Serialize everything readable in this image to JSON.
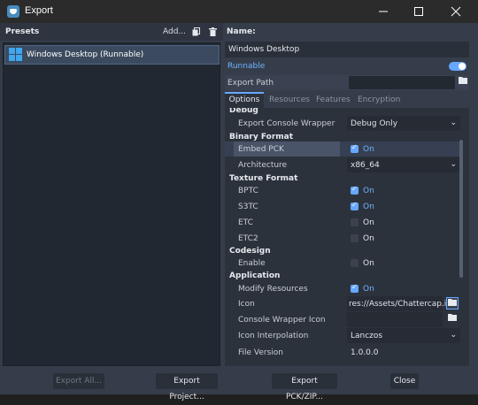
{
  "window": {
    "title": "Export",
    "minimize_icon": "minimize-icon",
    "maximize_icon": "maximize-icon",
    "close_icon": "close-icon"
  },
  "presets": {
    "header_label": "Presets",
    "add_label": "Add...",
    "items": [
      {
        "label": "Windows Desktop (Runnable)",
        "icon": "windows-logo-icon"
      }
    ]
  },
  "details": {
    "name_label": "Name:",
    "name_value": "Windows Desktop",
    "runnable_label": "Runnable",
    "runnable_on": true,
    "export_path_label": "Export Path",
    "export_path_value": ""
  },
  "tabs": [
    "Options",
    "Resources",
    "Features",
    "Encryption"
  ],
  "options": {
    "debug": {
      "header": "Debug",
      "console_wrapper_label": "Export Console Wrapper",
      "console_wrapper_value": "Debug Only"
    },
    "binary": {
      "header": "Binary Format",
      "embed_pck_label": "Embed PCK",
      "embed_pck_value": "On",
      "architecture_label": "Architecture",
      "architecture_value": "x86_64"
    },
    "texture": {
      "header": "Texture Format",
      "bptc_label": "BPTC",
      "bptc_value": "On",
      "s3tc_label": "S3TC",
      "s3tc_value": "On",
      "etc_label": "ETC",
      "etc_value": "On",
      "etc2_label": "ETC2",
      "etc2_value": "On"
    },
    "codesign": {
      "header": "Codesign",
      "enable_label": "Enable",
      "enable_value": "On"
    },
    "application": {
      "header": "Application",
      "modify_label": "Modify Resources",
      "modify_value": "On",
      "icon_label": "Icon",
      "icon_value": "res://Assets/Chattercap.ic",
      "wrapper_icon_label": "Console Wrapper Icon",
      "wrapper_icon_value": "",
      "interpolation_label": "Icon Interpolation",
      "interpolation_value": "Lanczos",
      "file_version_label": "File Version",
      "file_version_value": "1.0.0.0"
    }
  },
  "buttons": {
    "export_all": "Export All...",
    "export_project": "Export Project...",
    "export_pck": "Export PCK/ZIP...",
    "close": "Close"
  },
  "colors": {
    "accent": "#66a8ff",
    "panel_bg": "#2c323c",
    "window_bg": "#363d4a"
  }
}
